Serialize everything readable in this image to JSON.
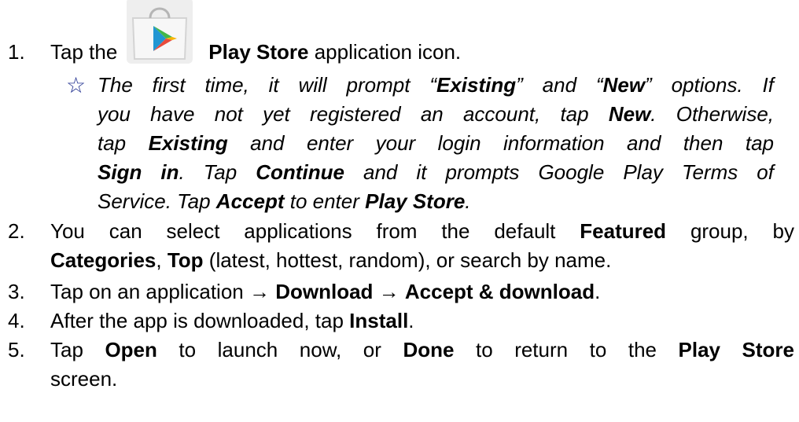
{
  "steps": [
    {
      "num": "1.",
      "pre": "Tap the",
      "b1": "Play Store",
      "post": " application icon."
    },
    {
      "num": "2."
    },
    {
      "num": "3.",
      "pre": "Tap on an application → ",
      "b1": "Download",
      "mid": " → ",
      "b2": "Accept & download",
      "post": "."
    },
    {
      "num": "4.",
      "pre": "After the app is downloaded, tap ",
      "b1": "Install",
      "post": "."
    },
    {
      "num": "5."
    }
  ],
  "note": {
    "star": "☆",
    "l1_a": "The first time, it will prompt “",
    "l1_b": "Existing",
    "l1_c": "” and “",
    "l1_d": "New",
    "l1_e": "” options. If",
    "l2_a": "you have not yet registered an account, tap ",
    "l2_b": "New",
    "l2_c": ". Otherwise,",
    "l3_a": "tap ",
    "l3_b": "Existing",
    "l3_c": " and enter your login information and then tap",
    "l4_a": "Sign in",
    "l4_b": ". Tap ",
    "l4_c": "Continue",
    "l4_d": " and it prompts Google Play Terms of",
    "l5_a": "Service. Tap ",
    "l5_b": "Accept",
    "l5_c": " to enter ",
    "l5_d": "Play Store",
    "l5_e": "."
  },
  "step2": {
    "l1_a": "You can select applications from the default ",
    "l1_b": "Featured",
    "l1_c": " group, by",
    "l2_a": "Categories",
    "l2_b": ", ",
    "l2_c": "Top",
    "l2_d": " (latest, hottest, random), or search by name."
  },
  "step5": {
    "l1_a": "Tap ",
    "l1_b": "Open",
    "l1_c": " to launch now, or ",
    "l1_d": "Done",
    "l1_e": " to return to the ",
    "l1_f": "Play Store",
    "l2_a": "screen."
  }
}
